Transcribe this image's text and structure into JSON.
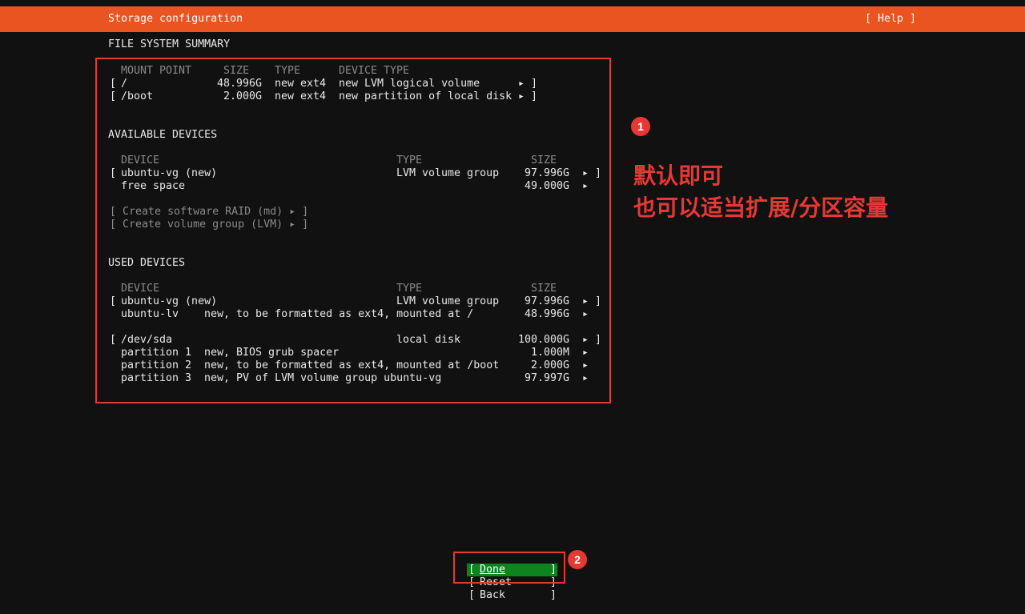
{
  "header": {
    "title": "Storage configuration",
    "help": "[ Help ]"
  },
  "fs_summary": {
    "heading": "FILE SYSTEM SUMMARY",
    "columns": [
      "MOUNT POINT",
      "SIZE",
      "TYPE",
      "DEVICE TYPE"
    ],
    "rows": [
      {
        "mount": "/",
        "size": "48.996G",
        "type": "new ext4",
        "device_type": "new LVM logical volume"
      },
      {
        "mount": "/boot",
        "size": "2.000G",
        "type": "new ext4",
        "device_type": "new partition of local disk"
      }
    ]
  },
  "available": {
    "heading": "AVAILABLE DEVICES",
    "columns": [
      "DEVICE",
      "TYPE",
      "SIZE"
    ],
    "rows": [
      {
        "device": "ubuntu-vg (new)",
        "type": "LVM volume group",
        "size": "97.996G"
      },
      {
        "device": "free space",
        "type": "",
        "size": "49.000G"
      }
    ],
    "create_raid": "[ Create software RAID (md) ▸ ]",
    "create_vg": "[ Create volume group (LVM) ▸ ]"
  },
  "used": {
    "heading": "USED DEVICES",
    "columns": [
      "DEVICE",
      "TYPE",
      "SIZE"
    ],
    "rows": [
      {
        "device": "ubuntu-vg (new)",
        "type": "LVM volume group",
        "size": "97.996G"
      },
      {
        "device": "ubuntu-lv",
        "type": "new, to be formatted as ext4, mounted at /",
        "size": "48.996G"
      },
      {
        "device": "/dev/sda",
        "type": "local disk",
        "size": "100.000G"
      },
      {
        "device": "partition 1",
        "type": "new, BIOS grub spacer",
        "size": "1.000M"
      },
      {
        "device": "partition 2",
        "type": "new, to be formatted as ext4, mounted at /boot",
        "size": "2.000G"
      },
      {
        "device": "partition 3",
        "type": "new, PV of LVM volume group ubuntu-vg",
        "size": "97.997G"
      }
    ]
  },
  "buttons": {
    "done": "Done",
    "reset": "Reset",
    "back": "Back"
  },
  "annotations": {
    "badge1": "1",
    "badge2": "2",
    "note_line1": "默认即可",
    "note_line2": "也可以适当扩展/分区容量"
  },
  "colors": {
    "accent": "#e95420",
    "highlight": "#0e8420",
    "annotation": "#e53935"
  },
  "icons": {
    "row_action": "triangle-right-icon"
  }
}
